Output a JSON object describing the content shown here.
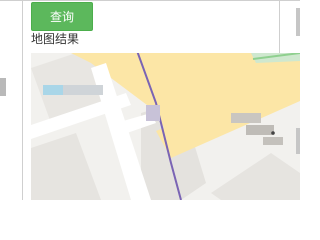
{
  "toolbar": {
    "query_label": "查询"
  },
  "results": {
    "heading": "地图结果"
  },
  "map": {
    "colors": {
      "background": "#f2f1ee",
      "primary_road": "#fce6a6",
      "secondary_road": "#ffffff",
      "transit_line": "#7a64b4",
      "park": "#c8e6c9",
      "building": "#e4e2de"
    }
  }
}
